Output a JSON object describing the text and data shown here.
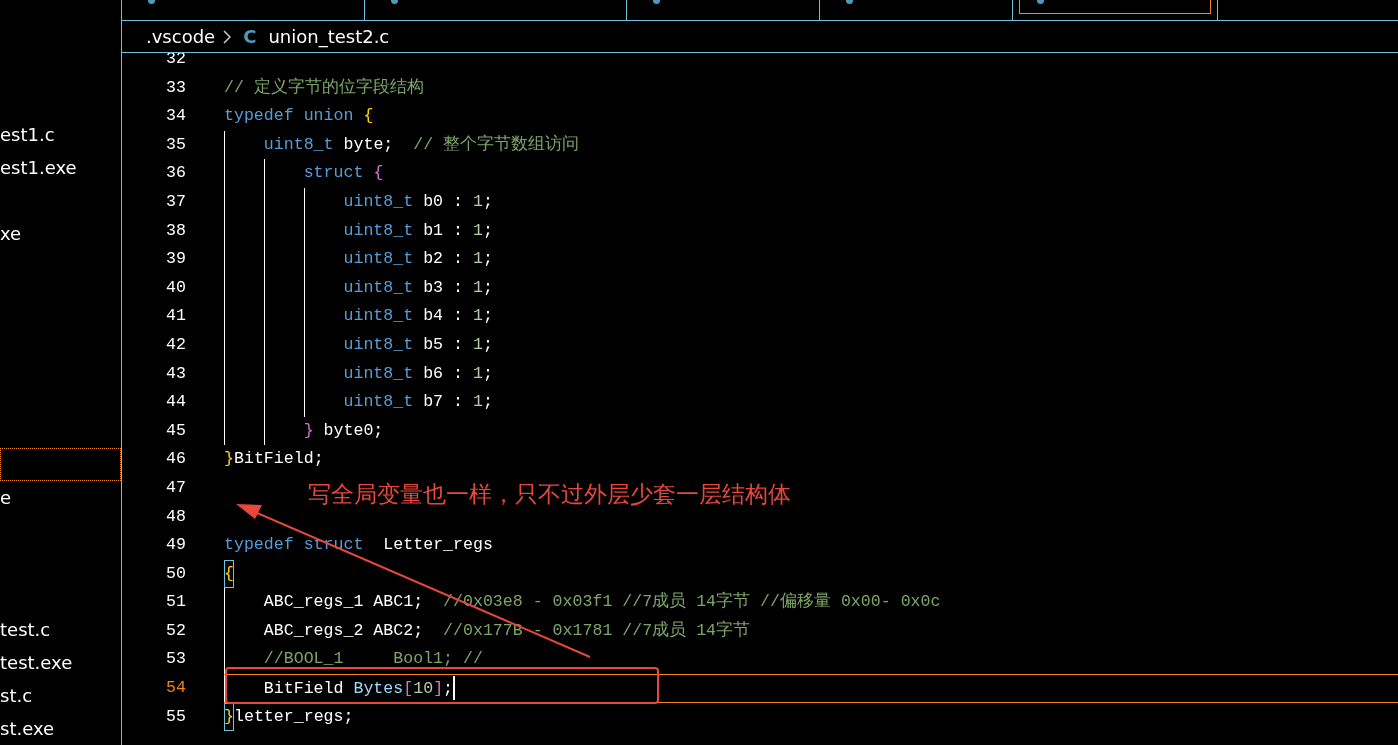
{
  "tabs": [
    {
      "selected": false
    },
    {
      "selected": false
    },
    {
      "selected": false
    },
    {
      "selected": false
    },
    {
      "selected": true
    }
  ],
  "sidebar": {
    "items": [
      {
        "label": "est1.c",
        "selected": false
      },
      {
        "label": "est1.exe",
        "selected": false
      },
      {
        "label": "xe",
        "selected": false
      },
      {
        "selected": true
      },
      {
        "label": "e",
        "selected": false
      },
      {
        "label": "test.c",
        "selected": false
      },
      {
        "label": "test.exe",
        "selected": false
      },
      {
        "label": "st.c",
        "selected": false
      },
      {
        "label": "st.exe",
        "selected": false
      }
    ]
  },
  "breadcrumb": {
    "folder": ".vscode",
    "file_icon": "C",
    "file": "union_test2.c"
  },
  "editor": {
    "lines": [
      {
        "num": "32",
        "current": false
      },
      {
        "num": "33",
        "current": false,
        "tokens": [
          {
            "kind": "comment",
            "text": "// 定义字节的位字段结构"
          }
        ]
      },
      {
        "num": "34",
        "current": false,
        "tokens": [
          {
            "kind": "keyword",
            "text": "typedef union "
          },
          {
            "kind": "bracket1",
            "text": "{"
          }
        ]
      },
      {
        "num": "35",
        "current": false,
        "tokens": [
          {
            "kind": "keyword",
            "text": "    uint8_t"
          },
          {
            "kind": "plain",
            "text": " byte;  "
          },
          {
            "kind": "comment",
            "text": "// 整个字节数组访问"
          }
        ]
      },
      {
        "num": "36",
        "current": false,
        "tokens": [
          {
            "kind": "keyword",
            "text": "        struct "
          },
          {
            "kind": "bracket2",
            "text": "{"
          }
        ]
      },
      {
        "num": "37",
        "current": false,
        "tokens": [
          {
            "kind": "keyword",
            "text": "            uint8_t"
          },
          {
            "kind": "plain",
            "text": " b0 : "
          },
          {
            "kind": "number",
            "text": "1"
          },
          {
            "kind": "plain",
            "text": ";"
          }
        ]
      },
      {
        "num": "38",
        "current": false,
        "tokens": [
          {
            "kind": "keyword",
            "text": "            uint8_t"
          },
          {
            "kind": "plain",
            "text": " b1 : "
          },
          {
            "kind": "number",
            "text": "1"
          },
          {
            "kind": "plain",
            "text": ";"
          }
        ]
      },
      {
        "num": "39",
        "current": false,
        "tokens": [
          {
            "kind": "keyword",
            "text": "            uint8_t"
          },
          {
            "kind": "plain",
            "text": " b2 : "
          },
          {
            "kind": "number",
            "text": "1"
          },
          {
            "kind": "plain",
            "text": ";"
          }
        ]
      },
      {
        "num": "40",
        "current": false,
        "tokens": [
          {
            "kind": "keyword",
            "text": "            uint8_t"
          },
          {
            "kind": "plain",
            "text": " b3 : "
          },
          {
            "kind": "number",
            "text": "1"
          },
          {
            "kind": "plain",
            "text": ";"
          }
        ]
      },
      {
        "num": "41",
        "current": false,
        "tokens": [
          {
            "kind": "keyword",
            "text": "            uint8_t"
          },
          {
            "kind": "plain",
            "text": " b4 : "
          },
          {
            "kind": "number",
            "text": "1"
          },
          {
            "kind": "plain",
            "text": ";"
          }
        ]
      },
      {
        "num": "42",
        "current": false,
        "tokens": [
          {
            "kind": "keyword",
            "text": "            uint8_t"
          },
          {
            "kind": "plain",
            "text": " b5 : "
          },
          {
            "kind": "number",
            "text": "1"
          },
          {
            "kind": "plain",
            "text": ";"
          }
        ]
      },
      {
        "num": "43",
        "current": false,
        "tokens": [
          {
            "kind": "keyword",
            "text": "            uint8_t"
          },
          {
            "kind": "plain",
            "text": " b6 : "
          },
          {
            "kind": "number",
            "text": "1"
          },
          {
            "kind": "plain",
            "text": ";"
          }
        ]
      },
      {
        "num": "44",
        "current": false,
        "tokens": [
          {
            "kind": "keyword",
            "text": "            uint8_t"
          },
          {
            "kind": "plain",
            "text": " b7 : "
          },
          {
            "kind": "number",
            "text": "1"
          },
          {
            "kind": "plain",
            "text": ";"
          }
        ]
      },
      {
        "num": "45",
        "current": false,
        "tokens": [
          {
            "kind": "bracket2",
            "text": "        }"
          },
          {
            "kind": "plain",
            "text": " byte0;"
          }
        ]
      },
      {
        "num": "46",
        "current": false,
        "tokens": [
          {
            "kind": "bracket1",
            "text": "}"
          },
          {
            "kind": "plain",
            "text": "BitField;"
          }
        ]
      },
      {
        "num": "47",
        "current": false
      },
      {
        "num": "48",
        "current": false
      },
      {
        "num": "49",
        "current": false,
        "tokens": [
          {
            "kind": "keyword",
            "text": "typedef struct"
          },
          {
            "kind": "plain",
            "text": "  Letter_regs"
          }
        ]
      },
      {
        "num": "50",
        "current": false,
        "tokens": [
          {
            "kind": "bracket1",
            "text": "{",
            "matched": true
          }
        ]
      },
      {
        "num": "51",
        "current": false,
        "tokens": [
          {
            "kind": "plain",
            "text": "    ABC_regs_1 ABC1;  "
          },
          {
            "kind": "comment",
            "text": "//0x03e8 - 0x03f1 //7成员 14字节 //偏移量 0x00- 0x0c"
          }
        ]
      },
      {
        "num": "52",
        "current": false,
        "tokens": [
          {
            "kind": "plain",
            "text": "    ABC_regs_2 ABC2;  "
          },
          {
            "kind": "comment",
            "text": "//0x177B - 0x1781 //7成员 14字节"
          }
        ]
      },
      {
        "num": "53",
        "current": false,
        "tokens": [
          {
            "kind": "comment",
            "text": "    //BOOL_1     Bool1; //"
          }
        ]
      },
      {
        "num": "54",
        "current": true,
        "cursor": true,
        "tokens": [
          {
            "kind": "plain",
            "text": "    BitField "
          },
          {
            "kind": "variable",
            "text": "Bytes"
          },
          {
            "kind": "bracket2",
            "text": "["
          },
          {
            "kind": "number",
            "text": "10"
          },
          {
            "kind": "bracket2",
            "text": "]"
          },
          {
            "kind": "plain",
            "text": ";"
          }
        ]
      },
      {
        "num": "55",
        "current": false,
        "tokens": [
          {
            "kind": "bracket1",
            "text": "}",
            "matched": true
          },
          {
            "kind": "plain",
            "text": "letter_regs;"
          }
        ]
      }
    ]
  },
  "annotation": {
    "text": "写全局变量也一样，只不过外层少套一层结构体"
  }
}
